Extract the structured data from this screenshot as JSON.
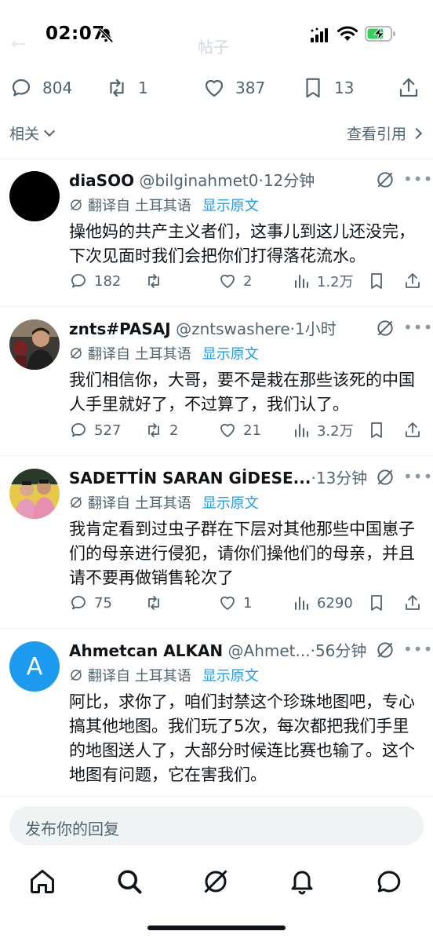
{
  "status_bar": {
    "time": "02:07",
    "faded_title": "帖子"
  },
  "stats": {
    "replies": "804",
    "retweets": "1",
    "likes": "387",
    "bookmarks": "13"
  },
  "filter": {
    "left_label": "相关",
    "right_label": "查看引用"
  },
  "translation": {
    "label": "翻译自 土耳其语",
    "show_original": "显示原文"
  },
  "replies": [
    {
      "name": "diaSOO",
      "handle": "@bilginahmet0",
      "time": "·12分钟",
      "text": "操他妈的共产主义者们，这事儿到这儿还没完，下次见面时我们会把你们打得落花流水。",
      "reply_count": "182",
      "retweet_count": "",
      "like_count": "2",
      "views": "1.2万",
      "avatar_color": "#000000"
    },
    {
      "name": "znts#PASAJ",
      "handle": "@zntswashere",
      "time": "·1小时",
      "text": "我们相信你，大哥，要不是栽在那些该死的中国人手里就好了，不过算了，我们认了。",
      "reply_count": "527",
      "retweet_count": "2",
      "like_count": "21",
      "views": "3.2万",
      "avatar_color": "#6b5a4a"
    },
    {
      "name": "SADETTİN SARAN GİDESE...",
      "handle": "",
      "time": "·13分钟",
      "text": "我肯定看到过虫子群在下层对其他那些中国崽子们的母亲进行侵犯，请你们操他们的母亲，并且请不要再做销售轮次了",
      "reply_count": "75",
      "retweet_count": "",
      "like_count": "1",
      "views": "6290",
      "avatar_color": "#c9a44a"
    },
    {
      "name": "Ahmetcan ALKAN",
      "handle": "@Ahmet...",
      "time": "·56分钟",
      "text": "阿比，求你了，咱们封禁这个珍珠地图吧，专心搞其他地图。我们玩了5次，每次都把我们手里的地图送人了，大部分时候连比赛也输了。这个地图有问题，它在害我们。",
      "avatar_letter": "A",
      "avatar_color": "#1d9bf0"
    }
  ],
  "compose": {
    "placeholder": "发布你的回复"
  }
}
